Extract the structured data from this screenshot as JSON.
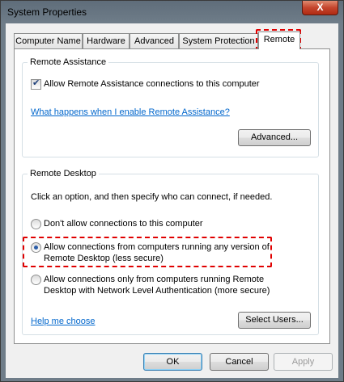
{
  "window": {
    "title": "System Properties",
    "close_glyph": "X"
  },
  "tabs": [
    {
      "label": "Computer Name"
    },
    {
      "label": "Hardware"
    },
    {
      "label": "Advanced"
    },
    {
      "label": "System Protection"
    },
    {
      "label": "Remote",
      "active": true
    }
  ],
  "remote_assistance": {
    "group_label": "Remote Assistance",
    "allow_checkbox_label": "Allow Remote Assistance connections to this computer",
    "allow_checked": true,
    "help_link": "What happens when I enable Remote Assistance?",
    "advanced_button": "Advanced..."
  },
  "remote_desktop": {
    "group_label": "Remote Desktop",
    "instruction": "Click an option, and then specify who can connect, if needed.",
    "options": [
      {
        "line1": "Don't allow connections to this computer",
        "line2": "",
        "selected": false
      },
      {
        "line1": "Allow connections from computers running any version of",
        "line2": "Remote Desktop (less secure)",
        "selected": true
      },
      {
        "line1": "Allow connections only from computers running Remote",
        "line2": "Desktop with Network Level Authentication (more secure)",
        "selected": false
      }
    ],
    "help_link": "Help me choose",
    "select_users_button": "Select Users..."
  },
  "footer": {
    "ok": "OK",
    "cancel": "Cancel",
    "apply": "Apply"
  },
  "colors": {
    "highlight": "#e00000",
    "link": "#0066cc"
  }
}
